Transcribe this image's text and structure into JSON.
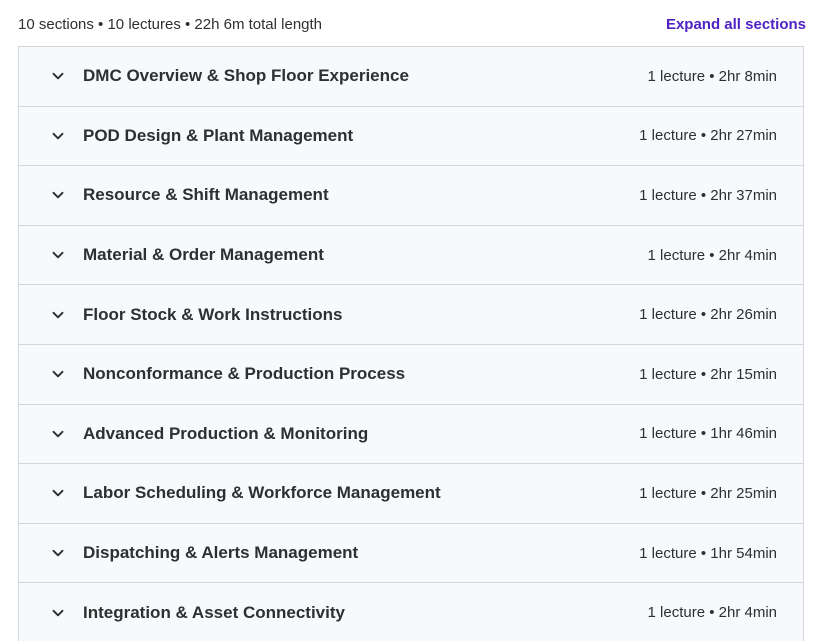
{
  "summary": {
    "text": "10 sections • 10 lectures • 22h 6m total length",
    "expand_label": "Expand all sections"
  },
  "icons": {
    "section_toggle": "chevron-down-icon"
  },
  "colors": {
    "link": "#5022c3",
    "row_background": "#f7f9fa",
    "border": "#d1d7dc",
    "text": "#2d2f31"
  },
  "sections": [
    {
      "title": "DMC Overview & Shop Floor Experience",
      "meta": "1 lecture • 2hr 8min"
    },
    {
      "title": "POD Design & Plant Management",
      "meta": "1 lecture • 2hr 27min"
    },
    {
      "title": "Resource & Shift Management",
      "meta": "1 lecture • 2hr 37min"
    },
    {
      "title": "Material & Order Management",
      "meta": "1 lecture • 2hr 4min"
    },
    {
      "title": "Floor Stock & Work Instructions",
      "meta": "1 lecture • 2hr 26min"
    },
    {
      "title": "Nonconformance & Production Process",
      "meta": "1 lecture • 2hr 15min"
    },
    {
      "title": "Advanced Production & Monitoring",
      "meta": "1 lecture • 1hr 46min"
    },
    {
      "title": "Labor Scheduling & Workforce Management",
      "meta": "1 lecture • 2hr 25min"
    },
    {
      "title": "Dispatching & Alerts Management",
      "meta": "1 lecture • 1hr 54min"
    },
    {
      "title": "Integration & Asset Connectivity",
      "meta": "1 lecture • 2hr 4min"
    }
  ]
}
